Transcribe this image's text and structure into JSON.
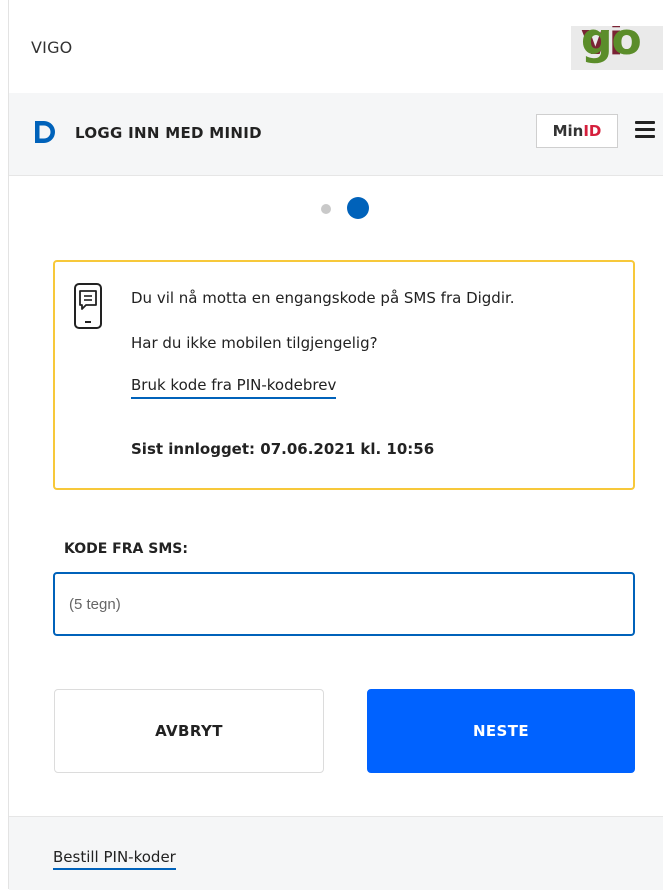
{
  "header": {
    "app_name": "VIGO",
    "logo_text_part1": "vi",
    "logo_text_part2": "go"
  },
  "minid_bar": {
    "title": "LOGG INN MED MINID",
    "badge_part1": "Min",
    "badge_part2": "ID",
    "menu_icon": "hamburger-menu-icon"
  },
  "steps": {
    "total": 2,
    "current": 2
  },
  "info": {
    "icon": "sms-message-icon",
    "message": "Du vil nå motta en engangskode på SMS fra Digdir.",
    "question": "Har du ikke mobilen tilgjengelig?",
    "pin_link": "Bruk kode fra PIN-kodebrev",
    "last_login": "Sist innlogget: 07.06.2021 kl. 10:56"
  },
  "form": {
    "label": "KODE FRA SMS:",
    "value": "",
    "placeholder": "(5 tegn)"
  },
  "buttons": {
    "cancel": "AVBRYT",
    "next": "NESTE"
  },
  "footer": {
    "link": "Bestill PIN-koder"
  },
  "colors": {
    "primary": "#0062ff",
    "link_underline": "#0062ba",
    "info_border": "#f7c83a"
  }
}
